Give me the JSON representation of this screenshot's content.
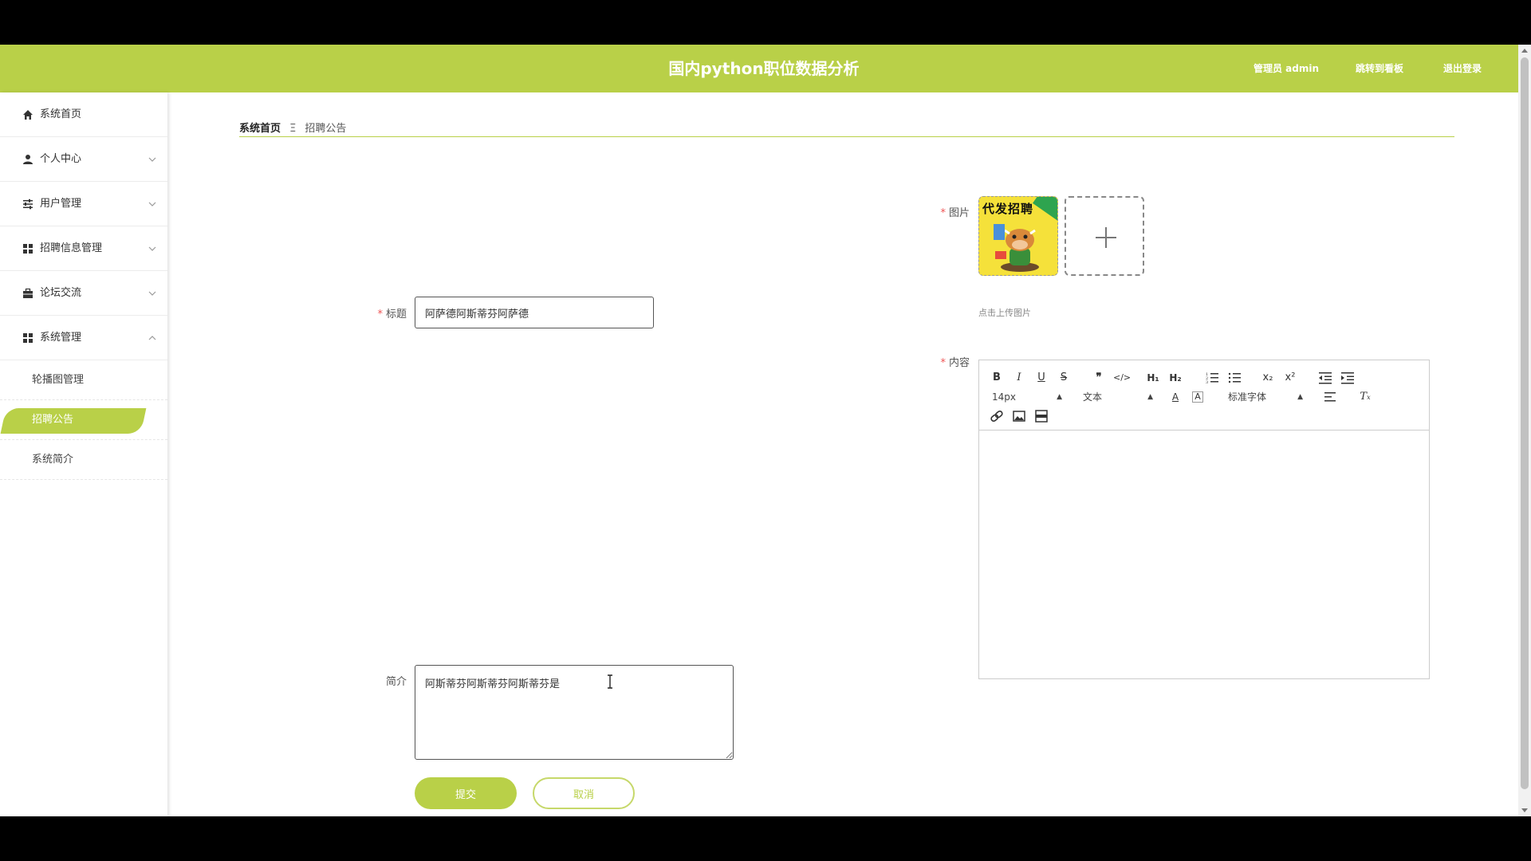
{
  "header": {
    "title": "国内python职位数据分析",
    "admin_label": "管理员 admin",
    "dashboard_link": "跳转到看板",
    "logout_link": "退出登录",
    "accent_color": "#b9d048"
  },
  "sidebar": {
    "items": [
      {
        "label": "系统首页",
        "icon": "home-icon"
      },
      {
        "label": "个人中心",
        "icon": "user-icon"
      },
      {
        "label": "用户管理",
        "icon": "sliders-icon"
      },
      {
        "label": "招聘信息管理",
        "icon": "grid-icon"
      },
      {
        "label": "论坛交流",
        "icon": "briefcase-icon"
      },
      {
        "label": "系统管理",
        "icon": "grid-icon"
      }
    ],
    "sub_items": [
      {
        "label": "轮播图管理"
      },
      {
        "label": "招聘公告"
      },
      {
        "label": "系统简介"
      }
    ]
  },
  "breadcrumb": {
    "home": "系统首页",
    "separator": "Ξ",
    "current": "招聘公告"
  },
  "form": {
    "title_label": "标题",
    "title_value": "阿萨德阿斯蒂芬阿萨德",
    "image_label": "图片",
    "thumb_text": "代发招聘",
    "upload_tip": "点击上传图片",
    "content_label": "内容",
    "intro_label": "简介",
    "intro_value": "阿斯蒂芬阿斯蒂芬阿斯蒂芬是",
    "submit_label": "提交",
    "cancel_label": "取消"
  },
  "editor": {
    "font_size": "14px",
    "header_select": "文本",
    "font_family": "标准字体"
  }
}
